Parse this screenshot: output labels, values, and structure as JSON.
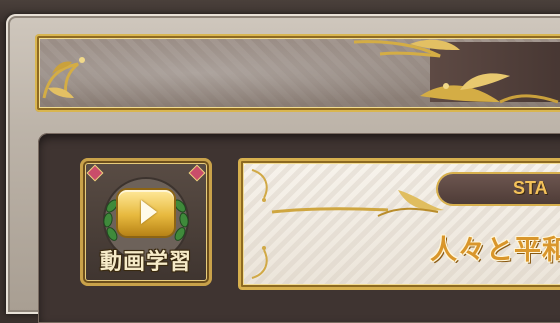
{
  "video_button": {
    "label": "動画学習",
    "icon": "play-icon"
  },
  "stage_card": {
    "tag": "STA",
    "title": "人々と平和"
  },
  "colors": {
    "gold": "#d7b04e",
    "dark_gold": "#8d6a22",
    "title_orange": "#d9962b",
    "panel_dark": "#3f3431",
    "frame_stone": "#c4bbb0"
  }
}
